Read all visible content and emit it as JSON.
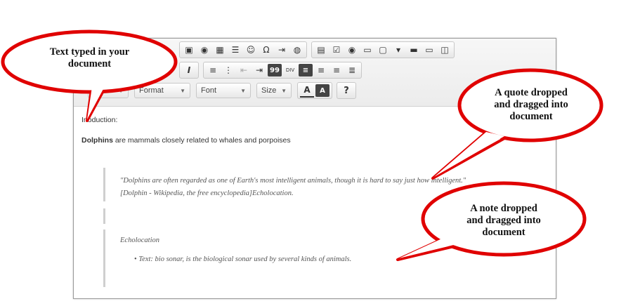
{
  "toolbar": {
    "row1_icons": [
      "image-icon",
      "flash-icon",
      "table-icon",
      "horizontal-line-icon",
      "smiley-icon",
      "special-char-icon",
      "page-break-icon",
      "iframe-icon",
      "form-icon",
      "checkbox-icon",
      "radio-icon",
      "textfield-icon",
      "textarea-icon",
      "select-icon",
      "button-icon",
      "image-button-icon",
      "hidden-field-icon"
    ],
    "row2_icons": [
      "remove-format-icon",
      "numbered-list-icon",
      "bulleted-list-icon",
      "outdent-icon",
      "indent-icon",
      "blockquote-icon",
      "div-icon",
      "align-left-icon",
      "align-center-icon",
      "align-right-icon",
      "justify-icon"
    ],
    "format_label": "Format",
    "font_label": "Font",
    "size_label": "Size",
    "text_color_label": "A",
    "bg_color_label": "A",
    "help_label": "?",
    "italic_clear_label": "I",
    "blockquote_label": "99",
    "div_label": "DIV"
  },
  "content": {
    "intro_prefix": "In",
    "intro_suffix": "oduction:",
    "dolphins_bold": "Dolphins",
    "dolphins_rest": " are mammals closely related to whales and porpoises",
    "quote_line1": "\"Dolphins are often regarded as one of Earth's most intelligent animals, though it is hard to say just how intelligent.\"",
    "quote_line2": "[Dolphin - Wikipedia, the free encyclopedia]Echolocation.",
    "note_heading": "Echolocation",
    "note_bullet": "Text: bio sonar, is the biological sonar used by several kinds of animals."
  },
  "callouts": {
    "typed_line1": "Text typed in your",
    "typed_line2": "document",
    "quote_line1": "A quote dropped",
    "quote_line2": "and dragged into",
    "quote_line3": "document",
    "note_line1": "A note dropped",
    "note_line2": "and dragged into",
    "note_line3": "document"
  },
  "colors": {
    "callout_border": "#e00000",
    "callout_fill": "#ffffff"
  }
}
